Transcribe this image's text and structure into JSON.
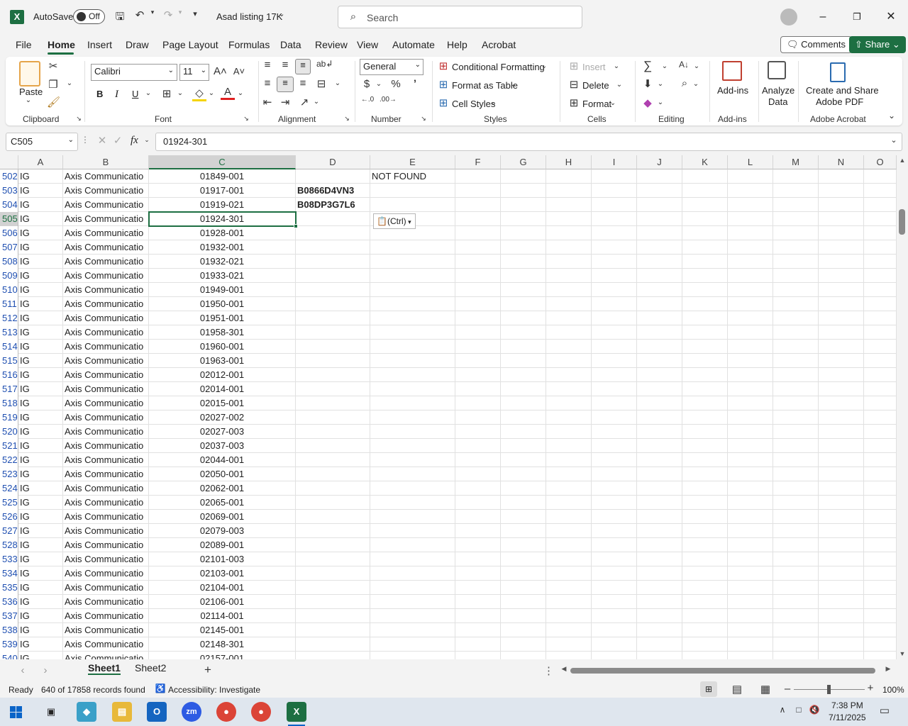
{
  "titlebar": {
    "autosave_label": "AutoSave",
    "autosave_state": "Off",
    "file_title": "Asad listing 17K",
    "search_placeholder": "Search"
  },
  "tabs": [
    "File",
    "Home",
    "Insert",
    "Draw",
    "Page Layout",
    "Formulas",
    "Data",
    "Review",
    "View",
    "Automate",
    "Help",
    "Acrobat"
  ],
  "tab_buttons": {
    "comments": "Comments",
    "share": "Share"
  },
  "ribbon": {
    "clipboard": {
      "paste": "Paste",
      "label": "Clipboard"
    },
    "font": {
      "name": "Calibri",
      "size": "11",
      "label": "Font",
      "bold": "B",
      "italic": "I",
      "underline": "U"
    },
    "alignment": {
      "label": "Alignment"
    },
    "number": {
      "format": "General",
      "label": "Number",
      "currency": "$",
      "percent": "%"
    },
    "styles": {
      "cond": "Conditional Formatting",
      "table": "Format as Table",
      "cell": "Cell Styles",
      "label": "Styles"
    },
    "cells": {
      "insert": "Insert",
      "delete": "Delete",
      "format": "Format",
      "label": "Cells"
    },
    "editing": {
      "label": "Editing"
    },
    "addins": {
      "btn": "Add-ins",
      "label": "Add-ins"
    },
    "analyze": {
      "line1": "Analyze",
      "line2": "Data"
    },
    "acrobat": {
      "line1": "Create and Share",
      "line2": "Adobe PDF",
      "label": "Adobe Acrobat"
    }
  },
  "formula_bar": {
    "name_box": "C505",
    "fx": "fx",
    "value": "01924-301"
  },
  "columns": [
    "A",
    "B",
    "C",
    "D",
    "E",
    "F",
    "G",
    "H",
    "I",
    "J",
    "K",
    "L",
    "M",
    "N",
    "O"
  ],
  "rows": [
    {
      "n": "502",
      "a": "IG",
      "b": "Axis Communicatio",
      "c": "01849-001",
      "d": "",
      "e": "NOT FOUND"
    },
    {
      "n": "503",
      "a": "IG",
      "b": "Axis Communicatio",
      "c": "01917-001",
      "d": "B0866D4VN3",
      "e": ""
    },
    {
      "n": "504",
      "a": "IG",
      "b": "Axis Communicatio",
      "c": "01919-021",
      "d": "B08DP3G7L6",
      "e": ""
    },
    {
      "n": "505",
      "a": "IG",
      "b": "Axis Communicatio",
      "c": "01924-301",
      "d": "",
      "e": ""
    },
    {
      "n": "506",
      "a": "IG",
      "b": "Axis Communicatio",
      "c": "01928-001",
      "d": "",
      "e": ""
    },
    {
      "n": "507",
      "a": "IG",
      "b": "Axis Communicatio",
      "c": "01932-001",
      "d": "",
      "e": ""
    },
    {
      "n": "508",
      "a": "IG",
      "b": "Axis Communicatio",
      "c": "01932-021",
      "d": "",
      "e": ""
    },
    {
      "n": "509",
      "a": "IG",
      "b": "Axis Communicatio",
      "c": "01933-021",
      "d": "",
      "e": ""
    },
    {
      "n": "510",
      "a": "IG",
      "b": "Axis Communicatio",
      "c": "01949-001",
      "d": "",
      "e": ""
    },
    {
      "n": "511",
      "a": "IG",
      "b": "Axis Communicatio",
      "c": "01950-001",
      "d": "",
      "e": ""
    },
    {
      "n": "512",
      "a": "IG",
      "b": "Axis Communicatio",
      "c": "01951-001",
      "d": "",
      "e": ""
    },
    {
      "n": "513",
      "a": "IG",
      "b": "Axis Communicatio",
      "c": "01958-301",
      "d": "",
      "e": ""
    },
    {
      "n": "514",
      "a": "IG",
      "b": "Axis Communicatio",
      "c": "01960-001",
      "d": "",
      "e": ""
    },
    {
      "n": "515",
      "a": "IG",
      "b": "Axis Communicatio",
      "c": "01963-001",
      "d": "",
      "e": ""
    },
    {
      "n": "516",
      "a": "IG",
      "b": "Axis Communicatio",
      "c": "02012-001",
      "d": "",
      "e": ""
    },
    {
      "n": "517",
      "a": "IG",
      "b": "Axis Communicatio",
      "c": "02014-001",
      "d": "",
      "e": ""
    },
    {
      "n": "518",
      "a": "IG",
      "b": "Axis Communicatio",
      "c": "02015-001",
      "d": "",
      "e": ""
    },
    {
      "n": "519",
      "a": "IG",
      "b": "Axis Communicatio",
      "c": "02027-002",
      "d": "",
      "e": ""
    },
    {
      "n": "520",
      "a": "IG",
      "b": "Axis Communicatio",
      "c": "02027-003",
      "d": "",
      "e": ""
    },
    {
      "n": "521",
      "a": "IG",
      "b": "Axis Communicatio",
      "c": "02037-003",
      "d": "",
      "e": ""
    },
    {
      "n": "522",
      "a": "IG",
      "b": "Axis Communicatio",
      "c": "02044-001",
      "d": "",
      "e": ""
    },
    {
      "n": "523",
      "a": "IG",
      "b": "Axis Communicatio",
      "c": "02050-001",
      "d": "",
      "e": ""
    },
    {
      "n": "524",
      "a": "IG",
      "b": "Axis Communicatio",
      "c": "02062-001",
      "d": "",
      "e": ""
    },
    {
      "n": "525",
      "a": "IG",
      "b": "Axis Communicatio",
      "c": "02065-001",
      "d": "",
      "e": ""
    },
    {
      "n": "526",
      "a": "IG",
      "b": "Axis Communicatio",
      "c": "02069-001",
      "d": "",
      "e": ""
    },
    {
      "n": "527",
      "a": "IG",
      "b": "Axis Communicatio",
      "c": "02079-003",
      "d": "",
      "e": ""
    },
    {
      "n": "528",
      "a": "IG",
      "b": "Axis Communicatio",
      "c": "02089-001",
      "d": "",
      "e": ""
    },
    {
      "n": "533",
      "a": "IG",
      "b": "Axis Communicatio",
      "c": "02101-003",
      "d": "",
      "e": ""
    },
    {
      "n": "534",
      "a": "IG",
      "b": "Axis Communicatio",
      "c": "02103-001",
      "d": "",
      "e": ""
    },
    {
      "n": "535",
      "a": "IG",
      "b": "Axis Communicatio",
      "c": "02104-001",
      "d": "",
      "e": ""
    },
    {
      "n": "536",
      "a": "IG",
      "b": "Axis Communicatio",
      "c": "02106-001",
      "d": "",
      "e": ""
    },
    {
      "n": "537",
      "a": "IG",
      "b": "Axis Communicatio",
      "c": "02114-001",
      "d": "",
      "e": ""
    },
    {
      "n": "538",
      "a": "IG",
      "b": "Axis Communicatio",
      "c": "02145-001",
      "d": "",
      "e": ""
    },
    {
      "n": "539",
      "a": "IG",
      "b": "Axis Communicatio",
      "c": "02148-301",
      "d": "",
      "e": ""
    },
    {
      "n": "540",
      "a": "IG",
      "b": "Axis Communicatio",
      "c": "02157-001",
      "d": "",
      "e": ""
    }
  ],
  "selected_row": "505",
  "paste_options": "(Ctrl)",
  "sheets": [
    "Sheet1",
    "Sheet2"
  ],
  "active_sheet": "Sheet1",
  "status": {
    "ready": "Ready",
    "records": "640 of 17858 records found",
    "accessibility": "Accessibility: Investigate",
    "zoom": "100%"
  },
  "taskbar": {
    "time": "7:38 PM",
    "date": "7/11/2025"
  },
  "colors": {
    "accent": "#1d6f42",
    "rowhdr_text": "#1e4eb0"
  }
}
